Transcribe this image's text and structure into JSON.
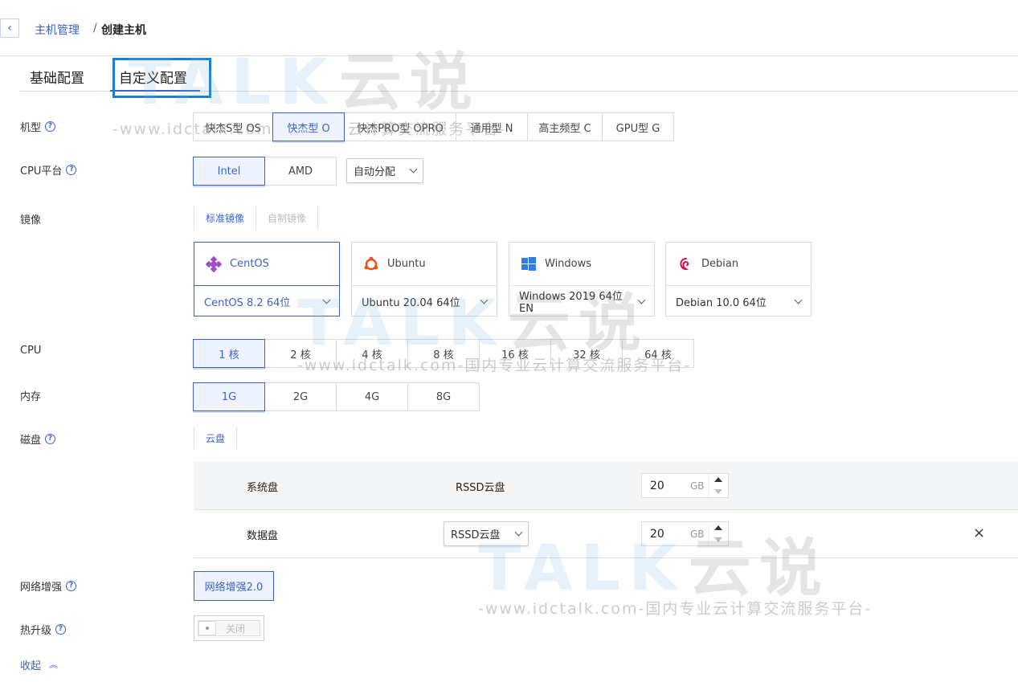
{
  "breadcrumb": {
    "back_icon": "chevron-left-icon",
    "parent": "主机管理",
    "separator": "/",
    "current": "创建主机"
  },
  "tabs": [
    {
      "label": "基础配置"
    },
    {
      "label": "自定义配置",
      "active": true
    }
  ],
  "labels": {
    "machine_type": "机型",
    "cpu_platform": "CPU平台",
    "image": "镜像",
    "cpu": "CPU",
    "memory": "内存",
    "disk": "磁盘",
    "network": "网络增强",
    "hot_upgrade": "热升级"
  },
  "machine_types": [
    "快杰S型 OS",
    "快杰型 O",
    "快杰PRO型 OPRO",
    "通用型 N",
    "高主频型 C",
    "GPU型 G"
  ],
  "machine_type_selected": "快杰型 O",
  "cpu_platforms": [
    "Intel",
    "AMD"
  ],
  "cpu_platform_selected": "Intel",
  "cpu_alloc": "自动分配",
  "image_tabs": [
    "标准镜像",
    "自制镜像"
  ],
  "os_cards": [
    {
      "name": "CentOS",
      "version": "CentOS 8.2 64位",
      "icon": "centos-icon",
      "active": true
    },
    {
      "name": "Ubuntu",
      "version": "Ubuntu 20.04 64位",
      "icon": "ubuntu-icon"
    },
    {
      "name": "Windows",
      "version": "Windows 2019 64位 EN",
      "icon": "windows-icon"
    },
    {
      "name": "Debian",
      "version": "Debian 10.0 64位",
      "icon": "debian-icon"
    }
  ],
  "cpu_options": [
    "1 核",
    "2 核",
    "4 核",
    "8 核",
    "16 核",
    "32 核",
    "64 核"
  ],
  "cpu_selected": "1 核",
  "memory_options": [
    "1G",
    "2G",
    "4G",
    "8G"
  ],
  "memory_selected": "1G",
  "disk_tab": "云盘",
  "disks": {
    "system": {
      "name": "系统盘",
      "type": "RSSD云盘",
      "size": "20",
      "unit": "GB"
    },
    "data": {
      "name": "数据盘",
      "type": "RSSD云盘",
      "size": "20",
      "unit": "GB",
      "close": "×"
    }
  },
  "network_option": "网络增强2.0",
  "hot_upgrade_state": "关闭",
  "collapse_label": "收起",
  "watermark": {
    "logo": "TALK",
    "logo_cn": "云说",
    "sub": "-www.idctalk.com-国内专业云计算交流服务平台-"
  },
  "colors": {
    "accent": "#3b62c9",
    "highlight_box": "#1a7fd4"
  }
}
